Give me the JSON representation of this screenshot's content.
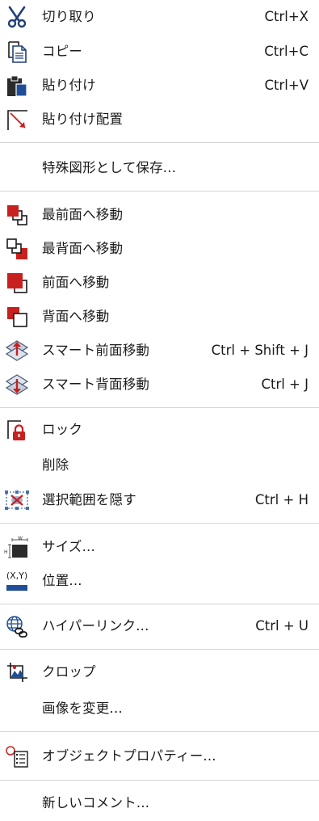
{
  "context_menu": {
    "items": [
      {
        "id": "cut",
        "label": "切り取り",
        "shortcut": "Ctrl+X",
        "icon": "scissors-icon"
      },
      {
        "id": "copy",
        "label": "コピー",
        "shortcut": "Ctrl+C",
        "icon": "copy-icon"
      },
      {
        "id": "paste",
        "label": "貼り付け",
        "shortcut": "Ctrl+V",
        "icon": "paste-icon"
      },
      {
        "id": "paste-place",
        "label": "貼り付け配置",
        "icon": "paste-placement-icon"
      },
      {
        "id": "save-special",
        "label": "特殊図形として保存..."
      },
      {
        "id": "bring-to-front",
        "label": "最前面へ移動",
        "icon": "bring-to-front-icon"
      },
      {
        "id": "send-to-back",
        "label": "最背面へ移動",
        "icon": "send-to-back-icon"
      },
      {
        "id": "bring-forward",
        "label": "前面へ移動",
        "icon": "bring-forward-icon"
      },
      {
        "id": "send-backward",
        "label": "背面へ移動",
        "icon": "send-backward-icon"
      },
      {
        "id": "smart-forward",
        "label": "スマート前面移動",
        "shortcut": "Ctrl + Shift + J",
        "icon": "smart-forward-icon"
      },
      {
        "id": "smart-backward",
        "label": "スマート背面移動",
        "shortcut": "Ctrl + J",
        "icon": "smart-backward-icon"
      },
      {
        "id": "lock",
        "label": "ロック",
        "icon": "lock-icon"
      },
      {
        "id": "delete",
        "label": "削除"
      },
      {
        "id": "hide-selection",
        "label": "選択範囲を隠す",
        "shortcut": "Ctrl + H",
        "icon": "hide-selection-icon"
      },
      {
        "id": "size",
        "label": "サイズ...",
        "icon": "size-icon"
      },
      {
        "id": "position",
        "label": "位置...",
        "icon": "position-icon"
      },
      {
        "id": "hyperlink",
        "label": "ハイパーリンク...",
        "shortcut": "Ctrl + U",
        "icon": "hyperlink-icon"
      },
      {
        "id": "crop",
        "label": "クロップ",
        "icon": "crop-icon"
      },
      {
        "id": "change-image",
        "label": "画像を変更..."
      },
      {
        "id": "object-properties",
        "label": "オブジェクトプロパティー...",
        "icon": "object-properties-icon"
      },
      {
        "id": "new-comment",
        "label": "新しいコメント..."
      }
    ],
    "icon_text": {
      "size_w": "W",
      "size_h": "H",
      "position_xy": "(X,Y)"
    },
    "colors": {
      "accent_red": "#c8201e",
      "accent_blue": "#1f4e96",
      "separator": "#d4d4d4"
    }
  }
}
